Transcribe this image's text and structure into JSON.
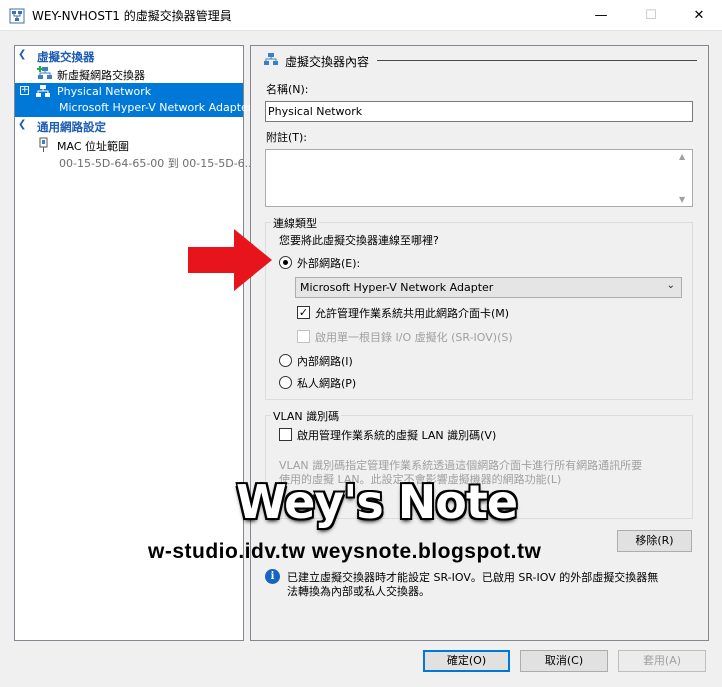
{
  "window": {
    "title": "WEY-NVHOST1 的虛擬交換器管理員"
  },
  "tree": {
    "section_switches": "虛擬交換器",
    "new_switch": "新虛擬網路交換器",
    "selected_name": "Physical Network",
    "selected_sub": "Microsoft Hyper-V Network Adapter",
    "section_global": "通用網路設定",
    "mac_label": "MAC 位址範圍",
    "mac_range": "00-15-5D-64-65-00 到 00-15-5D-6..."
  },
  "props": {
    "title": "虛擬交換器內容",
    "name_label": "名稱(N):",
    "name_value": "Physical Network",
    "notes_label": "附註(T):",
    "conn_group": "連線類型",
    "conn_question": "您要將此虛擬交換器連線至哪裡?",
    "external_label": "外部網路(E):",
    "adapter_selected": "Microsoft Hyper-V Network Adapter",
    "allow_mgmt_label": "允許管理作業系統共用此網路介面卡(M)",
    "sriov_label": "啟用單一根目錄 I/O 虛擬化 (SR-IOV)(S)",
    "internal_label": "內部網路(I)",
    "private_label": "私人網路(P)",
    "vlan_group": "VLAN 識別碼",
    "vlan_check_label": "啟用管理作業系統的虛擬 LAN 識別碼(V)",
    "vlan_desc_1": "VLAN 識別碼指定管理作業系統透過這個網路介面卡進行所有網路通訊所要",
    "vlan_desc_2": "使用的虛擬 LAN。此設定不會影響虛擬機器的網路功能(L)",
    "remove_button": "移除(R)",
    "info_1": "已建立虛擬交換器時才能設定 SR-IOV。已啟用 SR-IOV 的外部虛擬交換器無",
    "info_2": "法轉換為內部或私人交換器。"
  },
  "footer": {
    "ok": "確定(O)",
    "cancel": "取消(C)",
    "apply": "套用(A)"
  },
  "watermark": {
    "brand": "Wey's Note",
    "urls": "w-studio.idv.tw  weysnote.blogspot.tw"
  },
  "colors": {
    "selection": "#0078d7",
    "section_text": "#1c5cb3",
    "arrow": "#e8141b"
  }
}
